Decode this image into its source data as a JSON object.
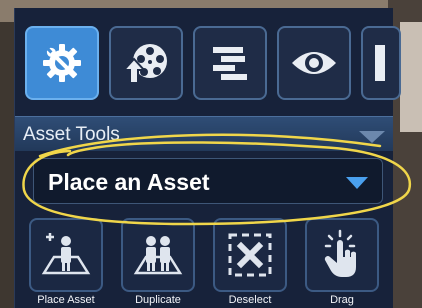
{
  "panel": {
    "tabs": [
      {
        "icon": "settings-tools-icon",
        "active": true
      },
      {
        "icon": "film-reel-upload-icon",
        "active": false
      },
      {
        "icon": "timeline-bars-icon",
        "active": false
      },
      {
        "icon": "eye-icon",
        "active": false
      },
      {
        "icon": "partial-tab-icon",
        "active": false
      }
    ],
    "section_title": "Asset Tools",
    "mode_dropdown": {
      "selected": "Place an Asset"
    },
    "tools": [
      {
        "label": "Place Asset",
        "icon": "place-asset-icon"
      },
      {
        "label": "Duplicate",
        "icon": "duplicate-icon"
      },
      {
        "label": "Deselect",
        "icon": "deselect-icon"
      },
      {
        "label": "Drag",
        "icon": "drag-hand-icon"
      }
    ]
  },
  "colors": {
    "accent": "#3e8bd6",
    "panel_bg": "#17223a",
    "annotation": "#f0d64a"
  }
}
